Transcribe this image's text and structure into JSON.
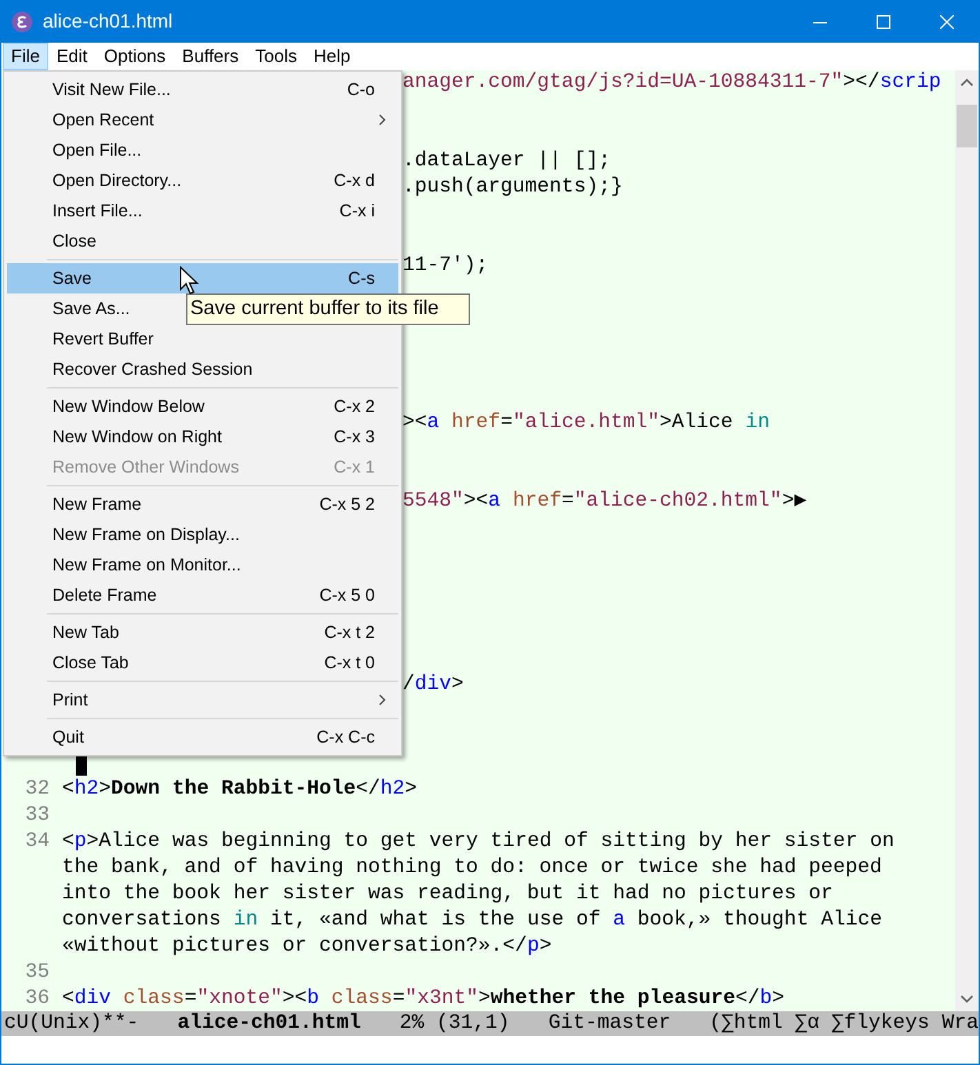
{
  "window": {
    "title": "alice-ch01.html"
  },
  "menubar": [
    {
      "label": "File",
      "selected": true
    },
    {
      "label": "Edit",
      "selected": false
    },
    {
      "label": "Options",
      "selected": false
    },
    {
      "label": "Buffers",
      "selected": false
    },
    {
      "label": "Tools",
      "selected": false
    },
    {
      "label": "Help",
      "selected": false
    }
  ],
  "menu": {
    "groups": [
      [
        {
          "label": "Visit New File...",
          "shortcut": "C-o",
          "submenu": false,
          "disabled": false,
          "selected": false
        },
        {
          "label": "Open Recent",
          "submenu": true,
          "disabled": false,
          "selected": false
        },
        {
          "label": "Open File...",
          "submenu": false,
          "disabled": false,
          "selected": false
        },
        {
          "label": "Open Directory...",
          "shortcut": "C-x d",
          "submenu": false,
          "disabled": false,
          "selected": false
        },
        {
          "label": "Insert File...",
          "shortcut": "C-x i",
          "submenu": false,
          "disabled": false,
          "selected": false
        },
        {
          "label": "Close",
          "submenu": false,
          "disabled": false,
          "selected": false
        }
      ],
      [
        {
          "label": "Save",
          "shortcut": "C-s",
          "submenu": false,
          "disabled": false,
          "selected": true
        },
        {
          "label": "Save As...",
          "disabled": false,
          "selected": false
        },
        {
          "label": "Revert Buffer",
          "submenu": false,
          "disabled": false,
          "selected": false
        },
        {
          "label": "Recover Crashed Session",
          "submenu": false,
          "disabled": false,
          "selected": false
        }
      ],
      [
        {
          "label": "New Window Below",
          "shortcut": "C-x 2",
          "submenu": false,
          "disabled": false,
          "selected": false
        },
        {
          "label": "New Window on Right",
          "shortcut": "C-x 3",
          "submenu": false,
          "disabled": false,
          "selected": false
        },
        {
          "label": "Remove Other Windows",
          "shortcut": "C-x 1",
          "submenu": false,
          "disabled": true,
          "selected": false
        }
      ],
      [
        {
          "label": "New Frame",
          "shortcut": "C-x 5 2",
          "submenu": false,
          "disabled": false,
          "selected": false
        },
        {
          "label": "New Frame on Display...",
          "submenu": false,
          "disabled": false,
          "selected": false
        },
        {
          "label": "New Frame on Monitor...",
          "submenu": false,
          "disabled": false,
          "selected": false
        },
        {
          "label": "Delete Frame",
          "shortcut": "C-x 5 0",
          "submenu": false,
          "disabled": false,
          "selected": false
        }
      ],
      [
        {
          "label": "New Tab",
          "shortcut": "C-x t 2",
          "submenu": false,
          "disabled": false,
          "selected": false
        },
        {
          "label": "Close Tab",
          "shortcut": "C-x t 0",
          "submenu": false,
          "disabled": false,
          "selected": false
        }
      ],
      [
        {
          "label": "Print",
          "submenu": true,
          "disabled": false,
          "selected": false
        }
      ],
      [
        {
          "label": "Quit",
          "shortcut": "C-x C-c",
          "submenu": false,
          "disabled": false,
          "selected": false
        }
      ]
    ]
  },
  "tooltip": "Save current buffer to its file",
  "editor": {
    "rows": [
      {
        "kind": "partial",
        "segments": [
          {
            "text": "anager.com/gtag/js?id=UA-10884311-7\"",
            "kind": "string"
          },
          {
            "text": "></",
            "kind": "plain"
          },
          {
            "text": "scrip",
            "kind": "tag"
          }
        ]
      },
      {
        "kind": "blank"
      },
      {
        "kind": "blank"
      },
      {
        "kind": "partial",
        "segments": [
          {
            "text": ".dataLayer || [];",
            "kind": "plain"
          }
        ]
      },
      {
        "kind": "partial",
        "segments": [
          {
            "text": ".push(arguments);}",
            "kind": "plain"
          }
        ]
      },
      {
        "kind": "blank"
      },
      {
        "kind": "blank"
      },
      {
        "kind": "partial",
        "segments": [
          {
            "text": "11-7');",
            "kind": "plain"
          }
        ]
      },
      {
        "kind": "blank"
      },
      {
        "kind": "blank"
      },
      {
        "kind": "blank"
      },
      {
        "kind": "blank"
      },
      {
        "kind": "blank"
      },
      {
        "kind": "partial",
        "segments": [
          {
            "text": "><",
            "kind": "plain"
          },
          {
            "text": "a",
            "kind": "tag"
          },
          {
            "text": " href",
            "kind": "attr"
          },
          {
            "text": "=",
            "kind": "plain"
          },
          {
            "text": "\"alice.html\"",
            "kind": "string"
          },
          {
            "text": ">Alice ",
            "kind": "plain"
          },
          {
            "text": "in",
            "kind": "keyword"
          }
        ]
      },
      {
        "kind": "blank"
      },
      {
        "kind": "blank"
      },
      {
        "kind": "partial",
        "segments": [
          {
            "text": "5548\"",
            "kind": "string"
          },
          {
            "text": "><",
            "kind": "plain"
          },
          {
            "text": "a",
            "kind": "tag"
          },
          {
            "text": " href",
            "kind": "attr"
          },
          {
            "text": "=",
            "kind": "plain"
          },
          {
            "text": "\"alice-ch02.html\"",
            "kind": "string"
          },
          {
            "text": ">▶",
            "kind": "plain"
          }
        ]
      },
      {
        "kind": "blank"
      },
      {
        "kind": "blank"
      },
      {
        "kind": "blank"
      },
      {
        "kind": "blank"
      },
      {
        "kind": "blank"
      },
      {
        "kind": "blank"
      },
      {
        "kind": "partial",
        "segments": [
          {
            "text": "/",
            "kind": "plain"
          },
          {
            "text": "div",
            "kind": "tag"
          },
          {
            "text": ">",
            "kind": "plain"
          }
        ]
      },
      {
        "kind": "blank"
      },
      {
        "kind": "blank"
      },
      {
        "kind": "cursor"
      },
      {
        "kind": "code",
        "number": "32",
        "segments": [
          {
            "text": "<",
            "kind": "plain"
          },
          {
            "text": "h2",
            "kind": "tag"
          },
          {
            "text": ">",
            "kind": "plain"
          },
          {
            "text": "Down the Rabbit-Hole",
            "kind": "bold"
          },
          {
            "text": "</",
            "kind": "plain"
          },
          {
            "text": "h2",
            "kind": "tag"
          },
          {
            "text": ">",
            "kind": "plain"
          }
        ]
      },
      {
        "kind": "code",
        "number": "33"
      },
      {
        "kind": "code",
        "number": "34",
        "segments": [
          {
            "text": "<",
            "kind": "plain"
          },
          {
            "text": "p",
            "kind": "tag"
          },
          {
            "text": ">Alice was beginning to get very tired of sitting by her sister on",
            "kind": "plain"
          }
        ]
      },
      {
        "kind": "code",
        "segments": [
          {
            "text": "the bank, and of having nothing to do: once or twice she had peeped",
            "kind": "plain"
          }
        ]
      },
      {
        "kind": "code",
        "segments": [
          {
            "text": "into the book her sister was reading, but it had no pictures or",
            "kind": "plain"
          }
        ]
      },
      {
        "kind": "code",
        "segments": [
          {
            "text": "conversations ",
            "kind": "plain"
          },
          {
            "text": "in",
            "kind": "keyword"
          },
          {
            "text": " it, «and what is the use of ",
            "kind": "plain"
          },
          {
            "text": "a",
            "kind": "tag"
          },
          {
            "text": " book,» thought Alice",
            "kind": "plain"
          }
        ]
      },
      {
        "kind": "code",
        "segments": [
          {
            "text": "«without pictures or conversation?».</",
            "kind": "plain"
          },
          {
            "text": "p",
            "kind": "tag"
          },
          {
            "text": ">",
            "kind": "plain"
          }
        ]
      },
      {
        "kind": "code",
        "number": "35"
      },
      {
        "kind": "code",
        "number": "36",
        "segments": [
          {
            "text": "<",
            "kind": "plain"
          },
          {
            "text": "div",
            "kind": "tag"
          },
          {
            "text": " class",
            "kind": "attr"
          },
          {
            "text": "=",
            "kind": "plain"
          },
          {
            "text": "\"xnote\"",
            "kind": "string"
          },
          {
            "text": "><",
            "kind": "plain"
          },
          {
            "text": "b",
            "kind": "tag"
          },
          {
            "text": " class",
            "kind": "attr"
          },
          {
            "text": "=",
            "kind": "plain"
          },
          {
            "text": "\"x3nt\"",
            "kind": "string"
          },
          {
            "text": ">",
            "kind": "plain"
          },
          {
            "text": "whether the pleasure",
            "kind": "bold"
          },
          {
            "text": "</",
            "kind": "plain"
          },
          {
            "text": "b",
            "kind": "tag"
          },
          {
            "text": ">",
            "kind": "plain"
          }
        ]
      }
    ]
  },
  "mode_line": [
    {
      "text": "cU(Unix)**-",
      "bold": false
    },
    {
      "text": "alice-ch01.html",
      "bold": true
    },
    {
      "text": "2% (31,1)",
      "bold": false
    },
    {
      "text": "Git-master",
      "bold": false
    },
    {
      "text": "(∑html ∑α ∑flykeys Wra",
      "bold": false
    }
  ]
}
